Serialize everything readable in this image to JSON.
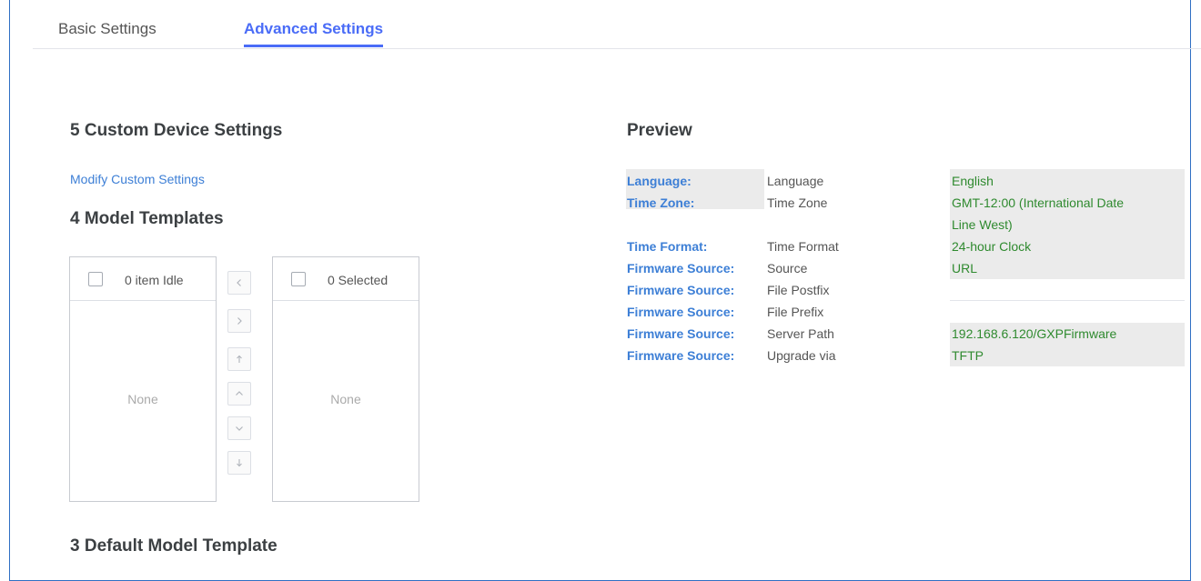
{
  "tabs": [
    {
      "label": "Basic Settings"
    },
    {
      "label": "Advanced Settings",
      "active": true
    }
  ],
  "custom_device": {
    "title": "5 Custom Device Settings",
    "link": "Modify Custom Settings"
  },
  "model_templates": {
    "title": "4 Model Templates",
    "idle": {
      "label": "0 item Idle",
      "empty": "None"
    },
    "selected": {
      "label": "0 Selected",
      "empty": "None"
    },
    "move_buttons": [
      "move-left",
      "move-right",
      "move-top",
      "move-up",
      "move-down",
      "move-bottom"
    ]
  },
  "default_model": {
    "title": "3 Default Model Template"
  },
  "preview": {
    "title": "Preview",
    "rows": [
      {
        "key": "Language:",
        "name": "Language",
        "value": "English"
      },
      {
        "key": "Time Zone:",
        "name": "Time Zone",
        "value": "GMT-12:00 (International Date",
        "value2": "Line West)"
      },
      {
        "key": "Time Format:",
        "name": "Time Format",
        "value": "24-hour Clock"
      },
      {
        "key": "Firmware Source:",
        "name": "Source",
        "value": "URL"
      },
      {
        "key": "Firmware Source:",
        "name": "File Postfix",
        "value": ""
      },
      {
        "key": "Firmware Source:",
        "name": "File Prefix",
        "value": ""
      },
      {
        "key": "Firmware Source:",
        "name": "Server Path",
        "value": "192.168.6.120/GXPFirmware"
      },
      {
        "key": "Firmware Source:",
        "name": "Upgrade via",
        "value": "TFTP"
      }
    ]
  },
  "colors": {
    "accent": "#4a6cf7",
    "link": "#3d7fd6",
    "value_green": "#2f8a2f",
    "frame_border": "#2f6fc4"
  }
}
